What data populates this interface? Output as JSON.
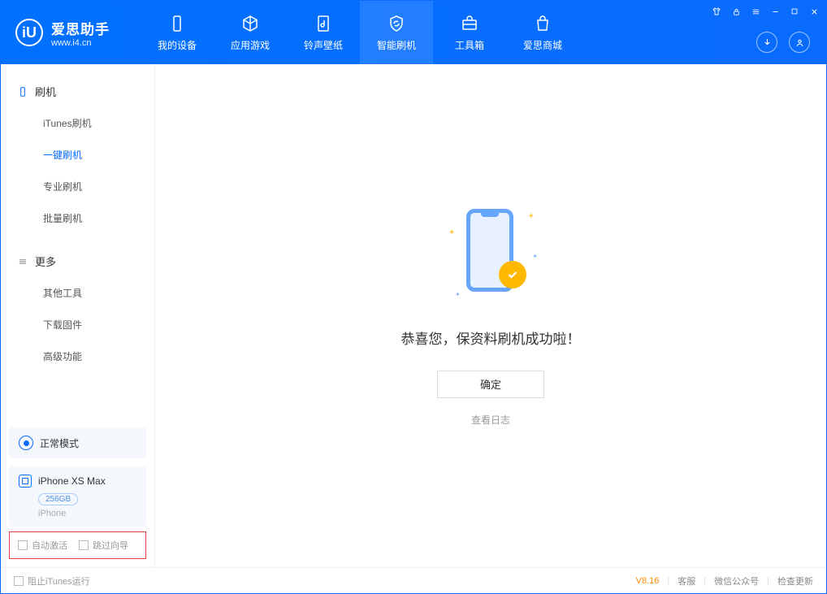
{
  "header": {
    "app_name": "爱思助手",
    "app_url": "www.i4.cn",
    "tabs": [
      {
        "label": "我的设备"
      },
      {
        "label": "应用游戏"
      },
      {
        "label": "铃声壁纸"
      },
      {
        "label": "智能刷机"
      },
      {
        "label": "工具箱"
      },
      {
        "label": "爱思商城"
      }
    ]
  },
  "sidebar": {
    "flash_section": "刷机",
    "flash_items": [
      "iTunes刷机",
      "一键刷机",
      "专业刷机",
      "批量刷机"
    ],
    "more_section": "更多",
    "more_items": [
      "其他工具",
      "下载固件",
      "高级功能"
    ],
    "mode_label": "正常模式",
    "device_name": "iPhone XS Max",
    "storage": "256GB",
    "device_type": "iPhone",
    "checkbox1": "自动激活",
    "checkbox2": "跳过向导"
  },
  "main": {
    "success_message": "恭喜您，保资料刷机成功啦！",
    "ok_button": "确定",
    "log_link": "查看日志"
  },
  "footer": {
    "block_itunes": "阻止iTunes运行",
    "version": "V8.16",
    "links": [
      "客服",
      "微信公众号",
      "检查更新"
    ]
  }
}
